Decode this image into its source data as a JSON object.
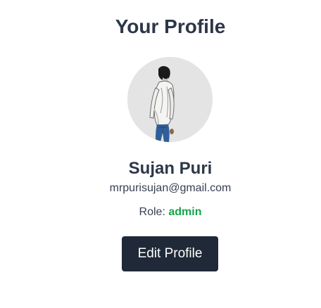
{
  "page": {
    "title": "Your Profile"
  },
  "profile": {
    "name": "Sujan Puri",
    "email": "mrpurisujan@gmail.com",
    "role_label": "Role:",
    "role_value": "admin",
    "avatar_icon": "user-avatar-photo"
  },
  "actions": {
    "edit_label": "Edit Profile"
  },
  "colors": {
    "heading": "#2d3748",
    "text": "#374151",
    "role_accent": "#16a34a",
    "button_bg": "#1f2937",
    "button_text": "#ffffff",
    "avatar_bg": "#e5e5e5"
  }
}
